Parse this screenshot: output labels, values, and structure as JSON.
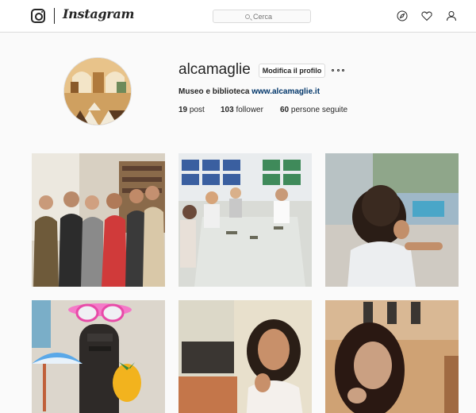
{
  "header": {
    "wordmark": "Instagram",
    "search_placeholder": "Cerca",
    "nav_icons": [
      "compass-icon",
      "heart-icon",
      "person-icon"
    ]
  },
  "profile": {
    "username": "alcamaglie",
    "edit_label": "Modifica il profilo",
    "bio_name": "Museo e biblioteca",
    "bio_link": "www.alcamaglie.it",
    "stats": [
      {
        "count": "19",
        "label": "post"
      },
      {
        "count": "103",
        "label": "follower"
      },
      {
        "count": "60",
        "label": "persone seguite"
      }
    ]
  },
  "posts": [
    {
      "subject": "group-photo"
    },
    {
      "subject": "kids-workshop"
    },
    {
      "subject": "child-at-window"
    },
    {
      "subject": "mask-sculpture"
    },
    {
      "subject": "woman-smiling"
    },
    {
      "subject": "woman-portrait"
    }
  ],
  "colors": {
    "accent_link": "#003569",
    "border": "#dbdbdb",
    "background": "#fafafa"
  }
}
